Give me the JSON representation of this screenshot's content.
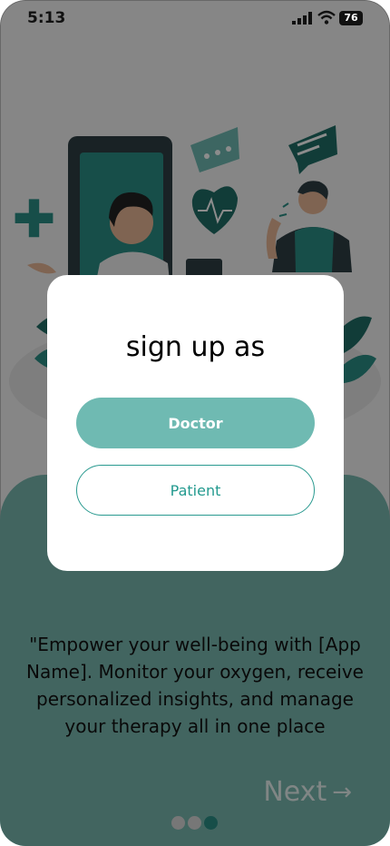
{
  "status_bar": {
    "time": "5:13",
    "battery": "76"
  },
  "modal": {
    "title": "sign up as",
    "doctor_label": "Doctor",
    "patient_label": "Patient"
  },
  "tagline": "\"Empower your well-being with [App Name]. Monitor your oxygen, receive personalized insights, and manage your therapy all in one place",
  "next": {
    "label": "Next",
    "arrow": "→"
  },
  "pager": {
    "count": 3,
    "active_index": 2
  },
  "colors": {
    "accent": "#6fbab2",
    "accent_dark": "#2a9a90",
    "panel": "#79b8b0"
  }
}
